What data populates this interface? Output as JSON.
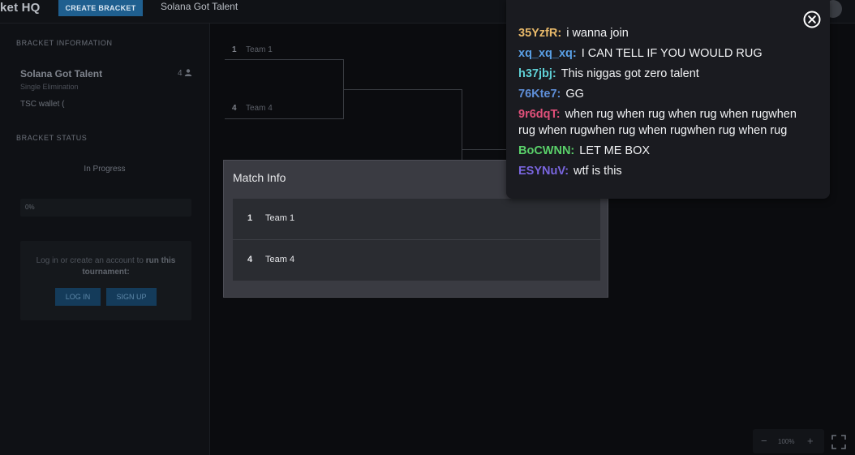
{
  "header": {
    "brand_bold": "ket HQ",
    "create_button": "CREATE BRACKET",
    "bracket_name": "Solana Got Talent"
  },
  "sidebar": {
    "info_heading": "BRACKET INFORMATION",
    "tournament_name": "Solana Got Talent",
    "tournament_type": "Single Elimination",
    "participant_count": "4",
    "wallet": "TSC wallet (",
    "status_heading": "BRACKET STATUS",
    "status": "In Progress",
    "progress_label": "0%",
    "progress_value": 0,
    "login_prompt_pre": "Log in or create an account to ",
    "login_prompt_bold": "run this tournament",
    "login_prompt_post": ":",
    "login_button": "LOG IN",
    "signup_button": "SIGN UP"
  },
  "bracket": {
    "slots": [
      {
        "seed": "1",
        "name": "Team 1"
      },
      {
        "seed": "4",
        "name": "Team 4"
      }
    ]
  },
  "match_info": {
    "title": "Match Info",
    "rows": [
      {
        "seed": "1",
        "name": "Team 1"
      },
      {
        "seed": "4",
        "name": "Team 4"
      }
    ]
  },
  "chat": {
    "messages": [
      {
        "user": "35YzfR:",
        "text": "i wanna join",
        "color": "#e8b96a"
      },
      {
        "user": "xq_xq_xq:",
        "text": "I CAN TELL IF YOU WOULD RUG",
        "color": "#5aa0e6"
      },
      {
        "user": "h37jbj:",
        "text": "This niggas got zero talent",
        "color": "#5fd0d6"
      },
      {
        "user": "76Kte7:",
        "text": "GG",
        "color": "#5e8ed8"
      },
      {
        "user": "9r6dqT:",
        "text": "when rug when rug when rug when rugwhen rug when rugwhen rug when rugwhen rug when rug",
        "color": "#e0507a"
      },
      {
        "user": "BoCWNN:",
        "text": "LET ME BOX",
        "color": "#5ad06a"
      },
      {
        "user": "ESYNuV:",
        "text": "wtf is this",
        "color": "#7a66e0"
      }
    ]
  },
  "zoom": {
    "minus": "−",
    "level": "100%",
    "plus": "+"
  }
}
